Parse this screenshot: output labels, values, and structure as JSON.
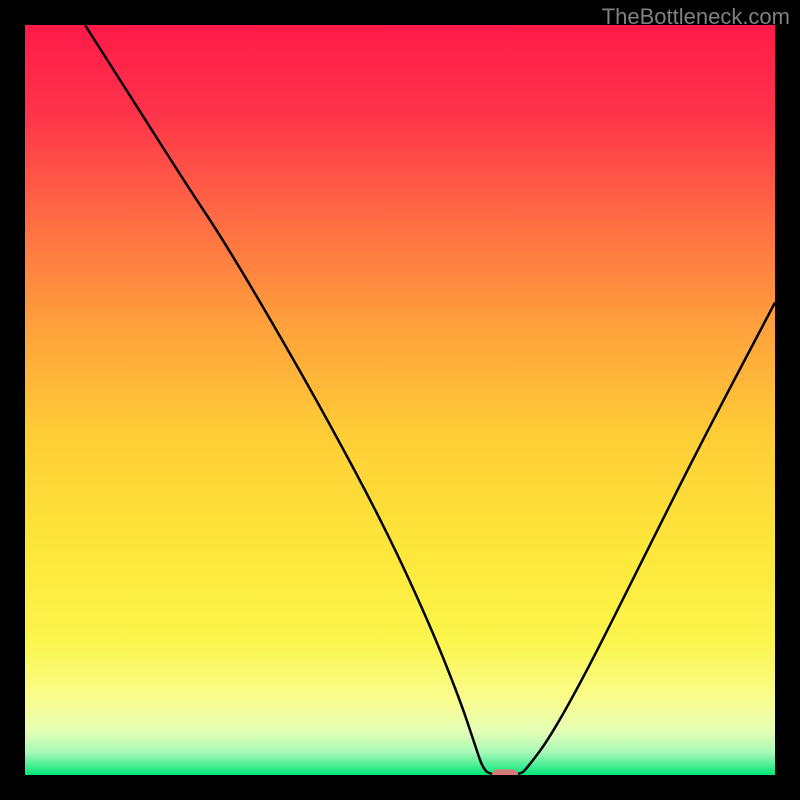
{
  "watermark": "TheBottleneck.com",
  "chart_data": {
    "type": "line",
    "title": "",
    "xlabel": "",
    "ylabel": "",
    "xlim": [
      0,
      100
    ],
    "ylim": [
      0,
      100
    ],
    "gradient_colors": {
      "top": "#FF1744",
      "upper_mid": "#FF6E40",
      "mid": "#FFD740",
      "lower_mid": "#FFFF8D",
      "bottom": "#00E676"
    },
    "curve": {
      "description": "V-shaped bottleneck curve",
      "points": [
        {
          "x": 8,
          "y": 100
        },
        {
          "x": 15,
          "y": 89
        },
        {
          "x": 22,
          "y": 78
        },
        {
          "x": 26,
          "y": 72
        },
        {
          "x": 32,
          "y": 62
        },
        {
          "x": 40,
          "y": 48
        },
        {
          "x": 48,
          "y": 33
        },
        {
          "x": 54,
          "y": 20
        },
        {
          "x": 58,
          "y": 10
        },
        {
          "x": 60,
          "y": 4
        },
        {
          "x": 61,
          "y": 1
        },
        {
          "x": 62,
          "y": 0
        },
        {
          "x": 66,
          "y": 0
        },
        {
          "x": 67,
          "y": 1
        },
        {
          "x": 70,
          "y": 5
        },
        {
          "x": 75,
          "y": 14
        },
        {
          "x": 82,
          "y": 28
        },
        {
          "x": 90,
          "y": 44
        },
        {
          "x": 100,
          "y": 63
        }
      ]
    },
    "marker": {
      "x": 64,
      "y": 0,
      "color": "#D47878",
      "width": 3.5,
      "height": 1.5
    }
  }
}
